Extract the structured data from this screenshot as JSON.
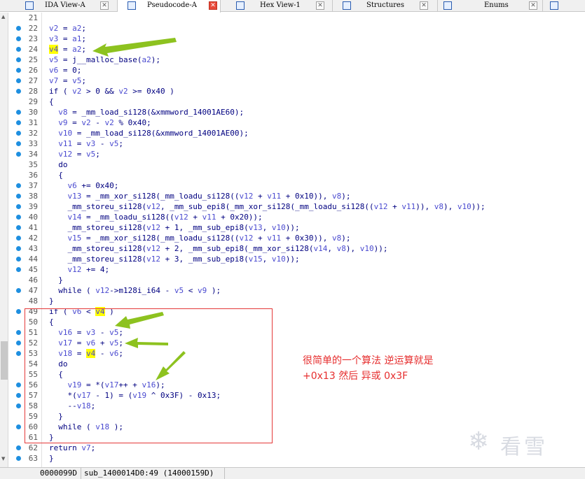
{
  "tabs": [
    {
      "label": "IDA View-A",
      "icon": "ida-view-icon"
    },
    {
      "label": "Pseudocode-A",
      "icon": "pseudocode-icon",
      "active": true
    },
    {
      "label": "Hex View-1",
      "icon": "hex-view-icon"
    },
    {
      "label": "Structures",
      "icon": "structures-icon"
    },
    {
      "label": "Enums",
      "icon": "enums-icon"
    },
    {
      "label": "",
      "icon": "imports-icon"
    }
  ],
  "code_lines": [
    {
      "num": "21",
      "text": "",
      "dot": false
    },
    {
      "num": "22",
      "text": "v2 = a2;",
      "dot": true
    },
    {
      "num": "23",
      "text": "v3 = a1;",
      "dot": true
    },
    {
      "num": "24",
      "text": "v4 = a2;",
      "dot": true
    },
    {
      "num": "25",
      "text": "v5 = j__malloc_base(a2);",
      "dot": true
    },
    {
      "num": "26",
      "text": "v6 = 0;",
      "dot": true
    },
    {
      "num": "27",
      "text": "v7 = v5;",
      "dot": true
    },
    {
      "num": "28",
      "text": "if ( v2 > 0 && v2 >= 0x40 )",
      "dot": true
    },
    {
      "num": "29",
      "text": "{",
      "dot": false
    },
    {
      "num": "30",
      "text": "  v8 = _mm_load_si128(&xmmword_14001AE60);",
      "dot": true
    },
    {
      "num": "31",
      "text": "  v9 = v2 - v2 % 0x40;",
      "dot": true
    },
    {
      "num": "32",
      "text": "  v10 = _mm_load_si128(&xmmword_14001AE00);",
      "dot": true
    },
    {
      "num": "33",
      "text": "  v11 = v3 - v5;",
      "dot": true
    },
    {
      "num": "34",
      "text": "  v12 = v5;",
      "dot": true
    },
    {
      "num": "35",
      "text": "  do",
      "dot": false
    },
    {
      "num": "36",
      "text": "  {",
      "dot": false
    },
    {
      "num": "37",
      "text": "    v6 += 0x40;",
      "dot": true
    },
    {
      "num": "38",
      "text": "    v13 = _mm_xor_si128(_mm_loadu_si128((v12 + v11 + 0x10)), v8);",
      "dot": true
    },
    {
      "num": "39",
      "text": "    _mm_storeu_si128(v12, _mm_sub_epi8(_mm_xor_si128(_mm_loadu_si128((v12 + v11)), v8), v10));",
      "dot": true
    },
    {
      "num": "40",
      "text": "    v14 = _mm_loadu_si128((v12 + v11 + 0x20));",
      "dot": true
    },
    {
      "num": "41",
      "text": "    _mm_storeu_si128(v12 + 1, _mm_sub_epi8(v13, v10));",
      "dot": true
    },
    {
      "num": "42",
      "text": "    v15 = _mm_xor_si128(_mm_loadu_si128((v12 + v11 + 0x30)), v8);",
      "dot": true
    },
    {
      "num": "43",
      "text": "    _mm_storeu_si128(v12 + 2, _mm_sub_epi8(_mm_xor_si128(v14, v8), v10));",
      "dot": true
    },
    {
      "num": "44",
      "text": "    _mm_storeu_si128(v12 + 3, _mm_sub_epi8(v15, v10));",
      "dot": true
    },
    {
      "num": "45",
      "text": "    v12 += 4;",
      "dot": true
    },
    {
      "num": "46",
      "text": "  }",
      "dot": false
    },
    {
      "num": "47",
      "text": "  while ( v12->m128i_i64 - v5 < v9 );",
      "dot": true
    },
    {
      "num": "48",
      "text": "}",
      "dot": false
    },
    {
      "num": "49",
      "text": "if ( v6 < v4 )",
      "dot": true
    },
    {
      "num": "50",
      "text": "{",
      "dot": false
    },
    {
      "num": "51",
      "text": "  v16 = v3 - v5;",
      "dot": true
    },
    {
      "num": "52",
      "text": "  v17 = v6 + v5;",
      "dot": true
    },
    {
      "num": "53",
      "text": "  v18 = v4 - v6;",
      "dot": true
    },
    {
      "num": "54",
      "text": "  do",
      "dot": false
    },
    {
      "num": "55",
      "text": "  {",
      "dot": false
    },
    {
      "num": "56",
      "text": "    v19 = *(v17++ + v16);",
      "dot": true
    },
    {
      "num": "57",
      "text": "    *(v17 - 1) = (v19 ^ 0x3F) - 0x13;",
      "dot": true
    },
    {
      "num": "58",
      "text": "    --v18;",
      "dot": true
    },
    {
      "num": "59",
      "text": "  }",
      "dot": false
    },
    {
      "num": "60",
      "text": "  while ( v18 );",
      "dot": true
    },
    {
      "num": "61",
      "text": "}",
      "dot": false
    },
    {
      "num": "62",
      "text": "return v7;",
      "dot": true
    },
    {
      "num": "63",
      "text": "}",
      "dot": true
    }
  ],
  "annotation": {
    "line1": "很简单的一个算法 逆运算就是",
    "line2": "+0x13 然后 异或 0x3F"
  },
  "status": {
    "offset": "0000099D",
    "location": "sub_1400014D0:49 (14000159D)"
  },
  "watermark": {
    "text": "看雪",
    "icon": "snowflake-icon"
  },
  "colors": {
    "arrow": "#8dc21f",
    "box": "#e43838",
    "note": "#e62e2e",
    "dot": "#1e8fe0",
    "highlight": "#ffff00"
  }
}
